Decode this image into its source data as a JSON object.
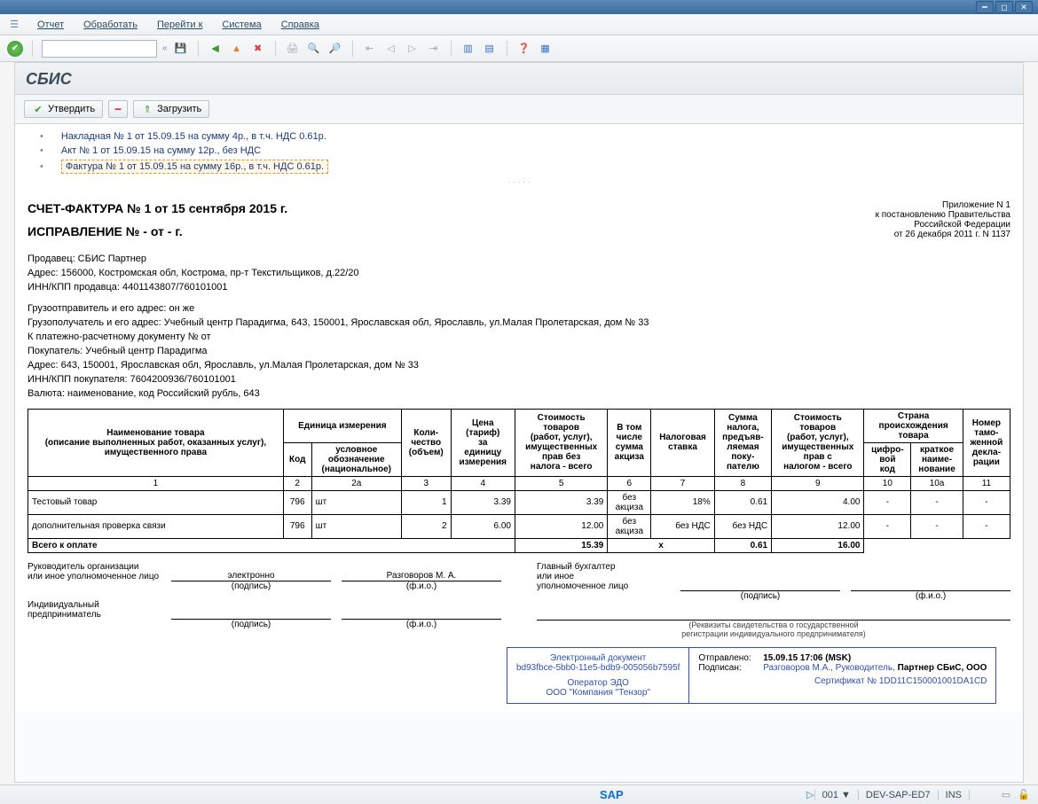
{
  "menu": {
    "icon": "menu-toggle",
    "items": [
      "Отчет",
      "Обработать",
      "Перейти к",
      "Система",
      "Справка"
    ]
  },
  "window_buttons": [
    "minimize",
    "maximize",
    "close"
  ],
  "panel_title": "СБИС",
  "actions": {
    "approve": "Утвердить",
    "remove_icon": "minus",
    "upload": "Загрузить"
  },
  "doc_list": [
    {
      "text": "Накладная № 1 от 15.09.15 на сумму 4р., в т.ч. НДС 0.61р.",
      "active": false
    },
    {
      "text": "Акт № 1 от 15.09.15 на сумму 12р., без НДС",
      "active": false
    },
    {
      "text": "Фактура № 1 от 15.09.15 на сумму 16р., в т.ч. НДС 0.61р.",
      "active": true
    }
  ],
  "invoice": {
    "title_line1": "СЧЕТ-ФАКТУРА № 1 от 15  сентября  2015 г.",
    "title_line2": "ИСПРАВЛЕНИЕ № - от -     г.",
    "annex": [
      "Приложение N 1",
      "к постановлению Правительства",
      "Российской Федерации",
      "от 26 декабря 2011 г. N 1137"
    ],
    "seller": [
      "Продавец: СБИС Партнер",
      "Адрес: 156000, Костромская обл, Кострома, пр-т Текстильщиков, д.22/20",
      "ИНН/КПП продавца: 4401143807/760101001"
    ],
    "misc": [
      "Грузоотправитель и его адрес:  он же",
      "Грузополучатель и его адрес: Учебный центр Парадигма, 643, 150001, Ярославская обл, Ярославль, ул.Малая Пролетарская, дом № 33",
      "К платежно-расчетному документу №  от",
      "Покупатель: Учебный центр Парадигма",
      "Адрес: 643, 150001, Ярославская обл, Ярославль, ул.Малая Пролетарская, дом № 33",
      "ИНН/КПП покупателя: 7604200936/760101001",
      "Валюта: наименование, код Российский рубль, 643"
    ],
    "headers": {
      "name": "Наименование товара\n(описание выполненных работ, оказанных услуг),\nимущественного права",
      "unit": "Единица измерения",
      "unit_code": "Код",
      "unit_desc": "условное\nобозначение\n(национальное)",
      "qty": "Коли-\nчество\n(объем)",
      "price": "Цена\n(тариф)\nза\nединицу\nизмерения",
      "cost_no_tax": "Стоимость\nтоваров\n(работ, услуг),\nимущественных\nправ без\nналога - всего",
      "excise": "В том\nчисле\nсумма\nакциза",
      "tax_rate": "Налоговая\nставка",
      "tax_sum": "Сумма\nналога,\nпредъяв-\nляемая\nпоку-\nпателю",
      "cost_with_tax": "Стоимость\nтоваров\n(работ, услуг),\nимущественных\nправ с\nналогом - всего",
      "origin": "Страна\nпроисхождения\nтовара",
      "origin_code": "цифро-\nвой\nкод",
      "origin_name": "краткое\nнаиме-\nнование",
      "declaration": "Номер\nтамо-\nженной\nдекла-\nрации"
    },
    "colnums": [
      "1",
      "2",
      "2а",
      "3",
      "4",
      "5",
      "6",
      "7",
      "8",
      "9",
      "10",
      "10а",
      "11"
    ],
    "rows": [
      {
        "name": "Тестовый товар",
        "code": "796",
        "unit": "шт",
        "qty": "1",
        "price": "3.39",
        "cost": "3.39",
        "excise": "без\nакциза",
        "rate": "18%",
        "tax": "0.61",
        "total": "4.00",
        "c1": "-",
        "c2": "-",
        "c3": "-"
      },
      {
        "name": "дополнительная проверка связи",
        "code": "796",
        "unit": "шт",
        "qty": "2",
        "price": "6.00",
        "cost": "12.00",
        "excise": "без\nакциза",
        "rate": "без НДС",
        "tax": "без НДС",
        "total": "12.00",
        "c1": "-",
        "c2": "-",
        "c3": "-"
      }
    ],
    "total_label": "Всего к оплате",
    "total": {
      "cost": "15.39",
      "x": "х",
      "tax": "0.61",
      "total": "16.00"
    },
    "sign": {
      "head": "Руководитель организации\nили иное уполномоченное лицо",
      "chief_acc": "Главный бухгалтер\nили иное\nуполномоченное лицо",
      "ip": "Индивидуальный предприниматель",
      "electronic": "электронно",
      "fio": "Разговоров М. А.",
      "sig_caption": "(подпись)",
      "fio_caption": "(ф.и.о.)",
      "req_caption": "(Реквизиты свидетельства о государственной\nрегистрации индивидуального предпринимателя)"
    },
    "edoc": {
      "left": [
        "Электронный документ",
        "bd93fbce-5bb0-11e5-bdb9-005056b7595f",
        "Оператор ЭДО",
        "ООО \"Компания \"Тензор\""
      ],
      "sent_label": "Отправлено:",
      "sent_value": "15.09.15 17:06 (MSK)",
      "signed_label": "Подписан:",
      "signed_value": "Разговоров М.А., Руководитель, Партнер СБиС, ООО",
      "cert": "Сертификат № 1DD11C150001001DA1CD"
    }
  },
  "status": {
    "sap": "SAP",
    "client": "001",
    "system": "DEV-SAP-ED7",
    "mode": "INS",
    "dropdown": "▼"
  }
}
